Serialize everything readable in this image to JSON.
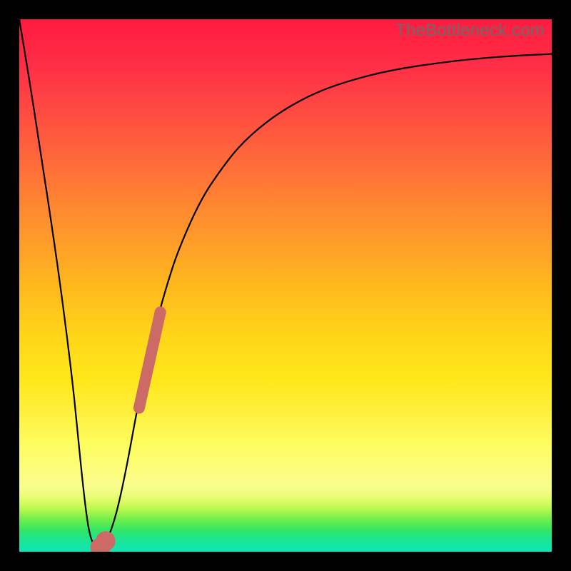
{
  "watermark": "TheBottleneck.com",
  "chart_data": {
    "type": "line",
    "title": "",
    "xlabel": "",
    "ylabel": "",
    "xlim": [
      0,
      100
    ],
    "ylim": [
      0,
      100
    ],
    "series": [
      {
        "name": "bottleneck-curve",
        "x": [
          0,
          2,
          4,
          6,
          8,
          10,
          11,
          12,
          13,
          14,
          15,
          16,
          18,
          20,
          22,
          24,
          26,
          28,
          30,
          34,
          38,
          42,
          48,
          55,
          62,
          70,
          80,
          90,
          100
        ],
        "y": [
          100,
          88,
          75,
          62,
          48,
          32,
          22,
          12,
          4,
          1,
          0,
          1,
          6,
          15,
          26,
          36,
          44,
          51,
          57,
          66,
          72,
          77,
          82,
          86,
          88.5,
          90.5,
          92,
          93,
          93.5
        ]
      }
    ],
    "markers": [
      {
        "name": "low-dot-1",
        "x": 15.2,
        "y": 0.8,
        "r": 1.2
      },
      {
        "name": "low-dot-2",
        "x": 16.2,
        "y": 2.0,
        "r": 1.2
      },
      {
        "name": "bar-segment",
        "x1": 22.5,
        "y1": 27,
        "x2": 26.5,
        "y2": 45
      }
    ],
    "marker_color": "#cc6b66",
    "curve_color": "#000000"
  }
}
